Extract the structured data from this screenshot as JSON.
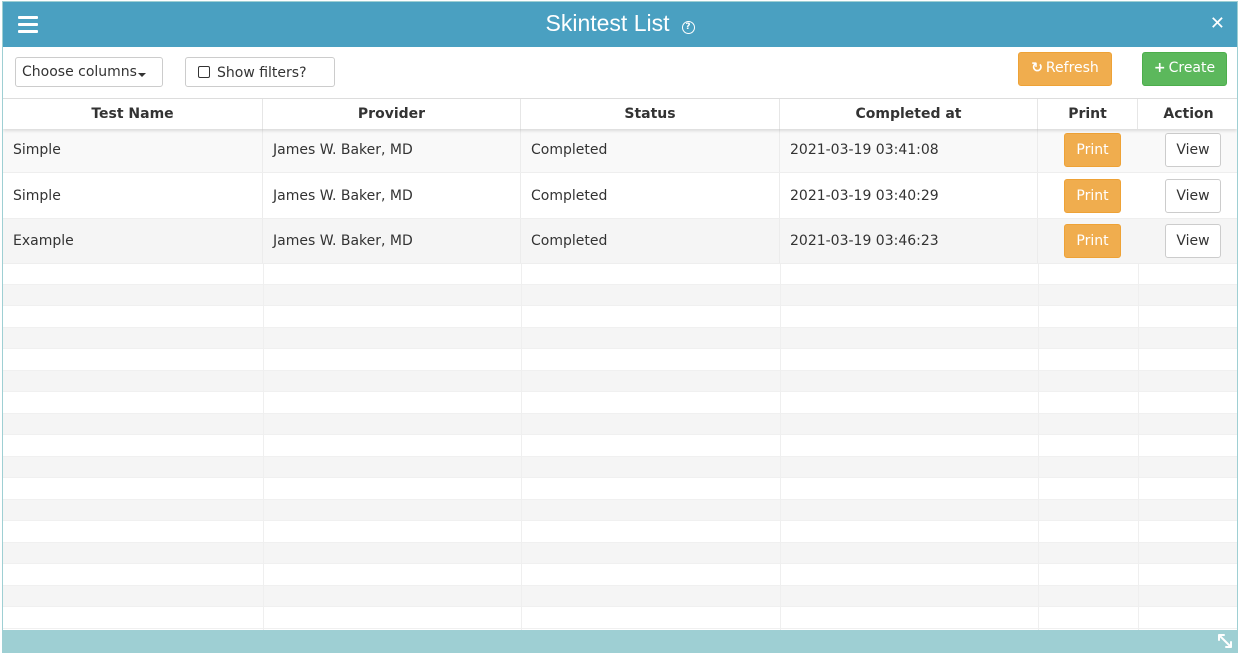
{
  "window": {
    "title": "Skintest List",
    "help_icon": "?",
    "close_icon": "✕"
  },
  "toolbar": {
    "choose_columns_label": "Choose columns",
    "show_filters_label": "Show filters?",
    "refresh_label": "Refresh",
    "refresh_icon": "↻",
    "create_label": "Create",
    "create_icon": "+"
  },
  "table": {
    "headers": [
      "Test Name",
      "Provider",
      "Status",
      "Completed at",
      "Print",
      "Action"
    ],
    "rows": [
      {
        "test_name": "Simple",
        "provider": "James W. Baker, MD",
        "status": "Completed",
        "completed_at": "2021-03-19 03:41:08",
        "print_label": "Print",
        "action_label": "View"
      },
      {
        "test_name": "Simple",
        "provider": "James W. Baker, MD",
        "status": "Completed",
        "completed_at": "2021-03-19 03:40:29",
        "print_label": "Print",
        "action_label": "View"
      },
      {
        "test_name": "Example",
        "provider": "James W. Baker, MD",
        "status": "Completed",
        "completed_at": "2021-03-19 03:46:23",
        "print_label": "Print",
        "action_label": "View"
      }
    ]
  },
  "colors": {
    "titlebar": "#4aa0c1",
    "footer": "#9ecfd3",
    "refresh": "#f0ad4e",
    "create": "#5cb85c",
    "print": "#f0ad4e"
  }
}
